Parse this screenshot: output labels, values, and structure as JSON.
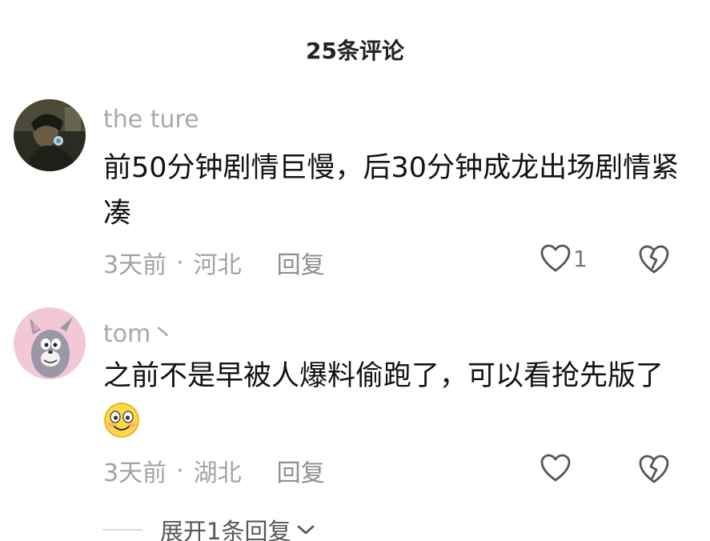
{
  "header": {
    "title": "25条评论"
  },
  "comments": [
    {
      "username": "the ture",
      "text": "前50分钟剧情巨慢，后30分钟成龙出场剧情紧凑",
      "time": "3天前",
      "separator": "·",
      "location": "河北",
      "reply_label": "回复",
      "like_count": "1",
      "avatar_icon": "dark-figure-avatar",
      "like_icon": "heart-icon",
      "dislike_icon": "broken-heart-icon"
    },
    {
      "username": "tom丶",
      "text": "之前不是早被人爆料偷跑了，可以看抢先版了",
      "emoji": "smiling-face-emoji",
      "time": "3天前",
      "separator": "·",
      "location": "湖北",
      "reply_label": "回复",
      "avatar_icon": "cartoon-cat-avatar",
      "like_icon": "heart-icon",
      "dislike_icon": "broken-heart-icon"
    }
  ],
  "expand_replies": {
    "label": "展开1条回复",
    "icon": "chevron-down-icon"
  },
  "colors": {
    "text_primary": "#121212",
    "text_secondary": "#a3a3a3",
    "avatar1_bg": "#3a3a2e",
    "avatar2_bg": "#f2c8d6"
  }
}
